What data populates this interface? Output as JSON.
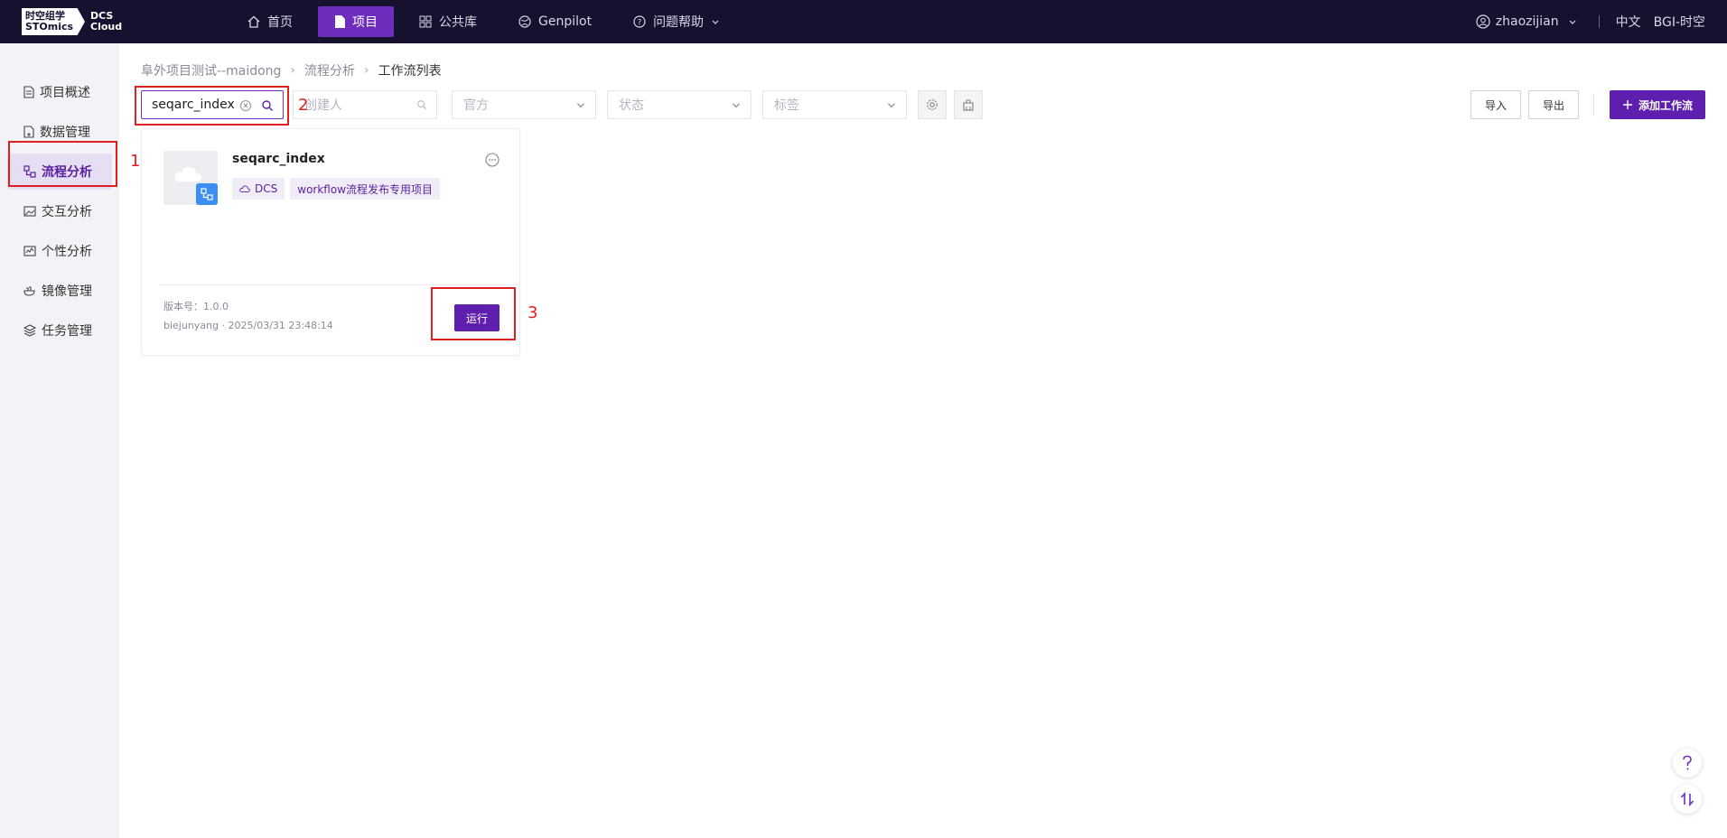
{
  "logo": {
    "cn_line1": "时空组学",
    "en_line2": "STOmics",
    "product_line1": "DCS",
    "product_line2": "Cloud"
  },
  "nav": [
    {
      "label": "首页",
      "icon": "home-icon"
    },
    {
      "label": "项目",
      "icon": "file-icon",
      "active": true
    },
    {
      "label": "公共库",
      "icon": "grid-icon"
    },
    {
      "label": "Genpilot",
      "icon": "globe-icon"
    },
    {
      "label": "问题帮助",
      "icon": "help-circle-icon"
    }
  ],
  "top_right": {
    "username": "zhaozijian",
    "language": "中文",
    "org": "BGI-时空"
  },
  "sidebar": [
    {
      "label": "项目概述",
      "icon": "document-icon"
    },
    {
      "label": "数据管理",
      "icon": "data-file-icon"
    },
    {
      "label": "流程分析",
      "icon": "workflow-icon",
      "active": true
    },
    {
      "label": "交互分析",
      "icon": "image-icon"
    },
    {
      "label": "个性分析",
      "icon": "chart-icon"
    },
    {
      "label": "镜像管理",
      "icon": "container-icon"
    },
    {
      "label": "任务管理",
      "icon": "layers-icon"
    }
  ],
  "breadcrumb": {
    "project": "阜外项目测试--maidong",
    "section": "流程分析",
    "current": "工作流列表"
  },
  "filters": {
    "search_value": "seqarc_index",
    "creator_placeholder": "创建人",
    "official_placeholder": "官方",
    "status_placeholder": "状态",
    "tag_placeholder": "标签"
  },
  "actions": {
    "import_label": "导入",
    "export_label": "导出",
    "add_label": "添加工作流"
  },
  "card": {
    "title": "seqarc_index",
    "tags": [
      "DCS",
      "workflow流程发布专用项目"
    ],
    "version": "版本号：1.0.0",
    "meta": "biejunyang · 2025/03/31 23:48:14",
    "run_label": "运行"
  },
  "annotations": [
    "1",
    "2",
    "3"
  ],
  "colors": {
    "accent": "#5f1fae",
    "topbar": "#15112f",
    "annotation": "#e02020"
  }
}
